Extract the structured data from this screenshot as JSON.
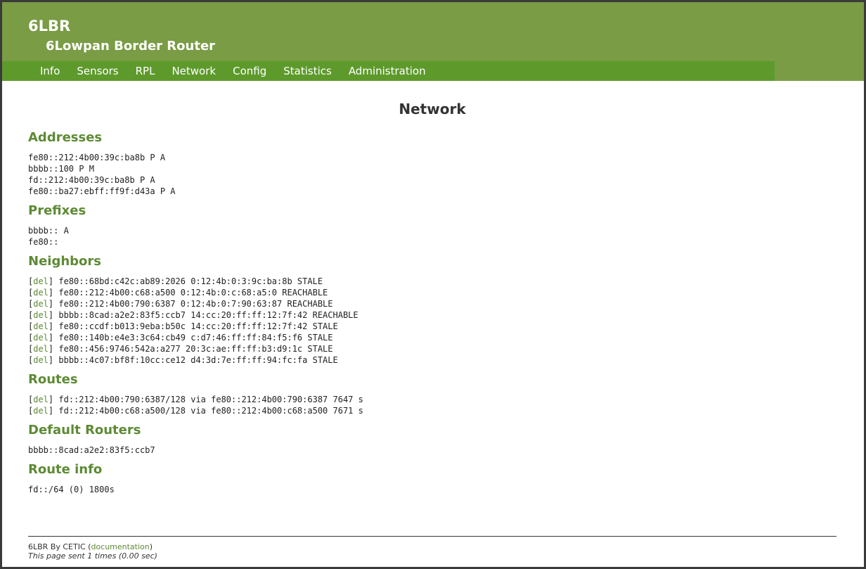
{
  "header": {
    "logo": "6LBR",
    "subtitle": "6Lowpan Border Router"
  },
  "nav": {
    "items": [
      "Info",
      "Sensors",
      "RPL",
      "Network",
      "Config",
      "Statistics",
      "Administration"
    ]
  },
  "page": {
    "title": "Network"
  },
  "sections": {
    "addresses": {
      "title": "Addresses",
      "lines": [
        "fe80::212:4b00:39c:ba8b P A",
        "bbbb::100 P M",
        "fd::212:4b00:39c:ba8b P A",
        "fe80::ba27:ebff:ff9f:d43a P A"
      ]
    },
    "prefixes": {
      "title": "Prefixes",
      "lines": [
        "bbbb:: A",
        "fe80::"
      ]
    },
    "neighbors": {
      "title": "Neighbors",
      "del_label": "del",
      "lines": [
        "fe80::68bd:c42c:ab89:2026 0:12:4b:0:3:9c:ba:8b STALE",
        "fe80::212:4b00:c68:a500 0:12:4b:0:c:68:a5:0 REACHABLE",
        "fe80::212:4b00:790:6387 0:12:4b:0:7:90:63:87 REACHABLE",
        "bbbb::8cad:a2e2:83f5:ccb7 14:cc:20:ff:ff:12:7f:42 REACHABLE",
        "fe80::ccdf:b013:9eba:b50c 14:cc:20:ff:ff:12:7f:42 STALE",
        "fe80::140b:e4e3:3c64:cb49 c:d7:46:ff:ff:84:f5:f6 STALE",
        "fe80::456:9746:542a:a277 20:3c:ae:ff:ff:b3:d9:1c STALE",
        "bbbb::4c07:bf8f:10cc:ce12 d4:3d:7e:ff:ff:94:fc:fa STALE"
      ]
    },
    "routes": {
      "title": "Routes",
      "del_label": "del",
      "lines": [
        "fd::212:4b00:790:6387/128 via fe80::212:4b00:790:6387 7647 s",
        "fd::212:4b00:c68:a500/128 via fe80::212:4b00:c68:a500 7671 s"
      ]
    },
    "default_routers": {
      "title": "Default Routers",
      "lines": [
        "bbbb::8cad:a2e2:83f5:ccb7"
      ]
    },
    "route_info": {
      "title": "Route info",
      "lines": [
        "fd::/64 (0) 1800s"
      ]
    }
  },
  "footer": {
    "credit_prefix": "6LBR By CETIC (",
    "link": "documentation",
    "credit_suffix": ")",
    "sent": "This page sent 1 times (0.00 sec)"
  },
  "colors": {
    "header_bg": "#7a9c45",
    "nav_bg": "#5d9a2b",
    "heading": "#5d8a34"
  }
}
